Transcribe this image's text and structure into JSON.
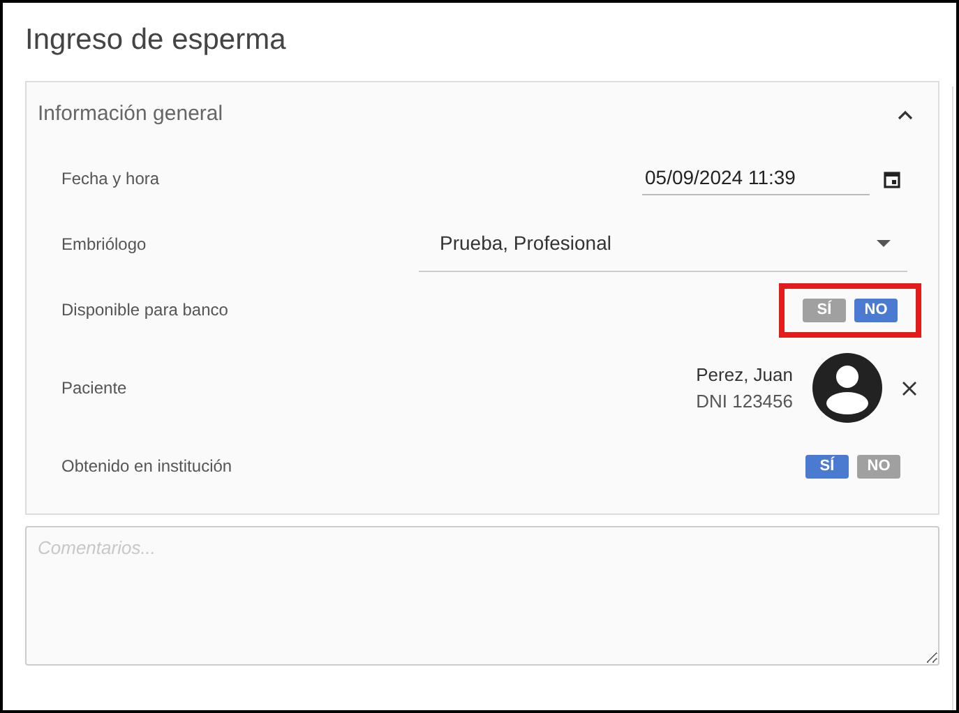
{
  "page": {
    "title": "Ingreso de esperma"
  },
  "section": {
    "title": "Información general",
    "expanded": true,
    "rows": [
      {
        "kind": "datetime",
        "label": "Fecha y hora",
        "value": "05/09/2024 11:39"
      },
      {
        "kind": "select",
        "label": "Embriólogo",
        "value": "Prueba, Profesional"
      },
      {
        "kind": "toggle",
        "label": "Disponible para banco",
        "highlighted": true,
        "options": [
          {
            "label": "SÍ",
            "selected": false
          },
          {
            "label": "NO",
            "selected": true
          }
        ]
      },
      {
        "kind": "patient",
        "label": "Paciente",
        "name": "Perez, Juan",
        "document": "DNI 123456"
      },
      {
        "kind": "toggle",
        "label": "Obtenido en institución",
        "highlighted": false,
        "options": [
          {
            "label": "SÍ",
            "selected": true
          },
          {
            "label": "NO",
            "selected": false
          }
        ]
      }
    ]
  },
  "comments": {
    "placeholder": "Comentarios..."
  }
}
